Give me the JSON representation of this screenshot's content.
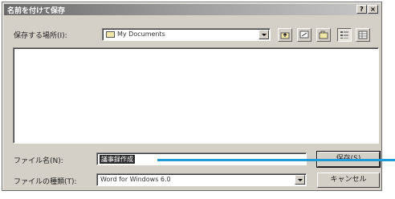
{
  "window": {
    "title": "名前を付けて保存",
    "help_glyph": "?",
    "close_glyph": "×"
  },
  "save_in": {
    "label": "保存する場所(I):",
    "value": "My Documents"
  },
  "filename": {
    "label": "ファイル名(N):",
    "value": "議事録作成",
    "save_button": "保存(S)"
  },
  "filetype": {
    "label": "ファイルの種類(T):",
    "value": "Word for Windows 6.0",
    "cancel_button": "キャンセル"
  },
  "colors": {
    "accent_line": "#1e9bd6",
    "dialog_face": "#d4d0c8"
  },
  "icons": [
    "folder-icon",
    "up-one-level-icon",
    "desktop-icon",
    "new-folder-icon",
    "list-view-icon",
    "details-view-icon"
  ]
}
